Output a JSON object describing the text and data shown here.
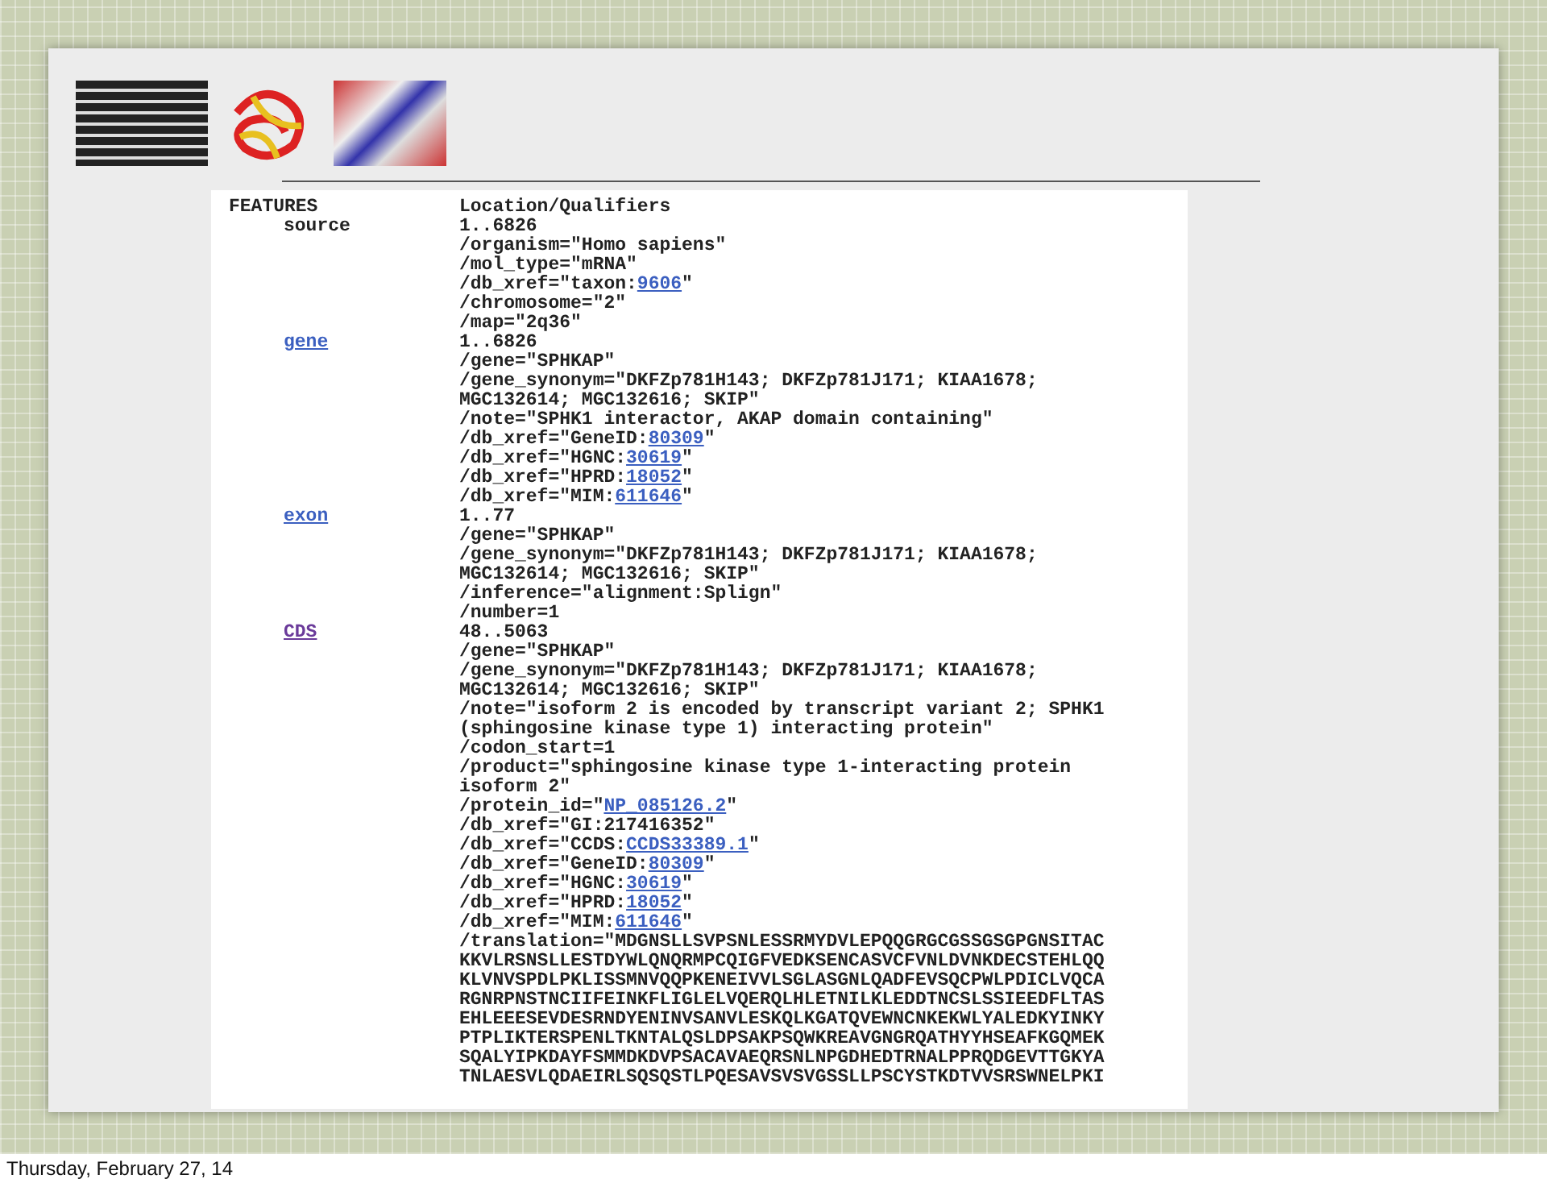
{
  "header": {
    "key": "FEATURES",
    "value": "Location/Qualifiers"
  },
  "features": [
    {
      "key": "source",
      "link": false,
      "location": "1..6826",
      "qualifiers": [
        {
          "text": "/organism=\"Homo sapiens\""
        },
        {
          "text": "/mol_type=\"mRNA\""
        },
        {
          "text": "/db_xref=\"taxon:",
          "link": "9606",
          "after": "\""
        },
        {
          "text": "/chromosome=\"2\""
        },
        {
          "text": "/map=\"2q36\""
        }
      ]
    },
    {
      "key": "gene",
      "link": true,
      "visited": false,
      "location": "1..6826",
      "qualifiers": [
        {
          "text": "/gene=\"SPHKAP\""
        },
        {
          "text": "/gene_synonym=\"DKFZp781H143; DKFZp781J171; KIAA1678;"
        },
        {
          "text": "MGC132614; MGC132616; SKIP\""
        },
        {
          "text": "/note=\"SPHK1 interactor, AKAP domain containing\""
        },
        {
          "text": "/db_xref=\"GeneID:",
          "link": "80309",
          "after": "\""
        },
        {
          "text": "/db_xref=\"HGNC:",
          "link": "30619",
          "after": "\""
        },
        {
          "text": "/db_xref=\"HPRD:",
          "link": "18052",
          "after": "\""
        },
        {
          "text": "/db_xref=\"MIM:",
          "link": "611646",
          "after": "\""
        }
      ]
    },
    {
      "key": "exon",
      "link": true,
      "visited": false,
      "location": "1..77",
      "qualifiers": [
        {
          "text": "/gene=\"SPHKAP\""
        },
        {
          "text": "/gene_synonym=\"DKFZp781H143; DKFZp781J171; KIAA1678;"
        },
        {
          "text": "MGC132614; MGC132616; SKIP\""
        },
        {
          "text": "/inference=\"alignment:Splign\""
        },
        {
          "text": "/number=1"
        }
      ]
    },
    {
      "key": "CDS",
      "link": true,
      "visited": true,
      "location": "48..5063",
      "qualifiers": [
        {
          "text": "/gene=\"SPHKAP\""
        },
        {
          "text": "/gene_synonym=\"DKFZp781H143; DKFZp781J171; KIAA1678;"
        },
        {
          "text": "MGC132614; MGC132616; SKIP\""
        },
        {
          "text": "/note=\"isoform 2 is encoded by transcript variant 2; SPHK1"
        },
        {
          "text": "(sphingosine kinase type 1) interacting protein\""
        },
        {
          "text": "/codon_start=1"
        },
        {
          "text": "/product=\"sphingosine kinase type 1-interacting protein"
        },
        {
          "text": "isoform 2\""
        },
        {
          "text": "/protein_id=\"",
          "link": "NP_085126.2",
          "after": "\""
        },
        {
          "text": "/db_xref=\"GI:217416352\""
        },
        {
          "text": "/db_xref=\"CCDS:",
          "link": "CCDS33389.1",
          "after": "\""
        },
        {
          "text": "/db_xref=\"GeneID:",
          "link": "80309",
          "after": "\""
        },
        {
          "text": "/db_xref=\"HGNC:",
          "link": "30619",
          "after": "\""
        },
        {
          "text": "/db_xref=\"HPRD:",
          "link": "18052",
          "after": "\""
        },
        {
          "text": "/db_xref=\"MIM:",
          "link": "611646",
          "after": "\""
        },
        {
          "text": "/translation=\"MDGNSLLSVPSNLESSRMYDVLEPQQGRGCGSSGSGPGNSITAC"
        },
        {
          "text": "KKVLRSNSLLESTDYWLQNQRMPCQIGFVEDKSENCASVCFVNLDVNKDECSTEHLQQ"
        },
        {
          "text": "KLVNVSPDLPKLISSMNVQQPKENEIVVLSGLASGNLQADFEVSQCPWLPDICLVQCA"
        },
        {
          "text": "RGNRPNSTNCIIFEINKFLIGLELVQERQLHLETNILKLEDDTNCSLSSIEEDFLTAS"
        },
        {
          "text": "EHLEEESEVDESRNDYENINVSANVLESKQLKGATQVEWNCNKEKWLYALEDKYINKY"
        },
        {
          "text": "PTPLIKTERSPENLTKNTALQSLDPSAKPSQWKREAVGNGRQATHYYHSEAFKGQMEK"
        },
        {
          "text": "SQALYIPKDAYFSMMDKDVPSACAVAEQRSNLNPGDHEDTRNALPPRQDGEVTTGKYA"
        },
        {
          "text": "TNLAESVLQDAEIRLSQSQSTLPQESAVSVSVGSSLLPSCYSTKDTVVSRSWNELPKI"
        }
      ]
    }
  ],
  "footer": "Thursday, February 27, 14"
}
